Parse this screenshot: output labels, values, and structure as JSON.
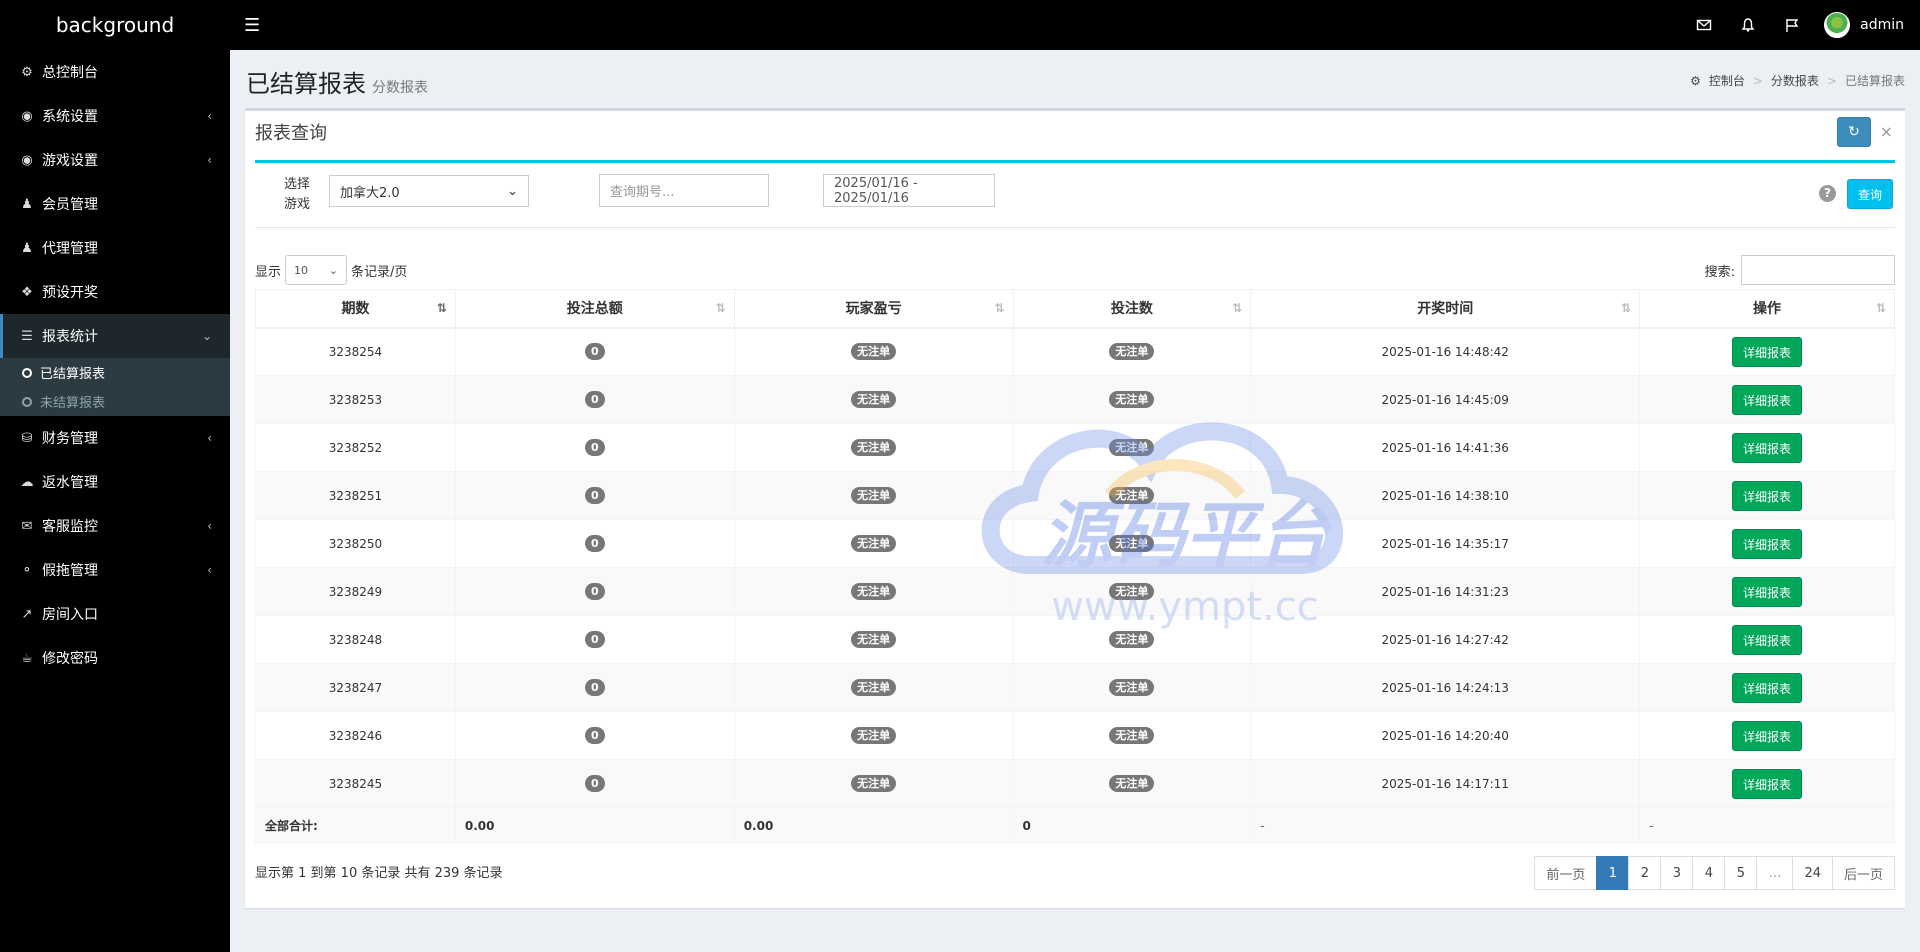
{
  "header": {
    "logo": "background",
    "menu_icon": "hamburger-icon",
    "icons": [
      "envelope-icon",
      "bell-icon",
      "flag-icon"
    ],
    "username": "admin"
  },
  "sidebar": {
    "items": [
      {
        "label": "总控制台",
        "icon": "dashboard-icon",
        "chevron": false
      },
      {
        "label": "系统设置",
        "icon": "gamepad-icon",
        "chevron": true
      },
      {
        "label": "游戏设置",
        "icon": "gamepad-icon",
        "chevron": true
      },
      {
        "label": "会员管理",
        "icon": "users-icon",
        "chevron": false
      },
      {
        "label": "代理管理",
        "icon": "users-icon",
        "chevron": false
      },
      {
        "label": "预设开奖",
        "icon": "cubes-icon",
        "chevron": false
      },
      {
        "label": "报表统计",
        "icon": "list-icon",
        "chevron": true,
        "expanded": true
      },
      {
        "label": "财务管理",
        "icon": "database-icon",
        "chevron": true
      },
      {
        "label": "返水管理",
        "icon": "cloud-upload-icon",
        "chevron": false
      },
      {
        "label": "客服监控",
        "icon": "chat-icon",
        "chevron": true
      },
      {
        "label": "假拖管理",
        "icon": "comment-icon",
        "chevron": true
      },
      {
        "label": "房间入口",
        "icon": "external-link-icon",
        "chevron": false
      },
      {
        "label": "修改密码",
        "icon": "cart-icon",
        "chevron": false
      }
    ],
    "sub_items": [
      {
        "label": "已结算报表",
        "active": true
      },
      {
        "label": "未结算报表",
        "active": false
      }
    ]
  },
  "page": {
    "title": "已结算报表",
    "subtitle": "分数报表",
    "breadcrumb": [
      "控制台",
      "分数报表",
      "已结算报表"
    ]
  },
  "box": {
    "title": "报表查询"
  },
  "filters": {
    "game_label": "选择游戏",
    "game_value": "加拿大2.0",
    "period_placeholder": "查询期号...",
    "date_range": "2025/01/16 - 2025/01/16",
    "query_label": "查询"
  },
  "table_controls": {
    "show_label": "显示",
    "page_size": "10",
    "per_page_label": "条记录/页",
    "search_label": "搜索:"
  },
  "table": {
    "columns": [
      "期数",
      "投注总额",
      "玩家盈亏",
      "投注数",
      "开奖时间",
      "操作"
    ],
    "no_bet_label": "无注单",
    "detail_label": "详细报表",
    "rows": [
      {
        "period": "3238254",
        "total": "0",
        "time": "2025-01-16 14:48:42"
      },
      {
        "period": "3238253",
        "total": "0",
        "time": "2025-01-16 14:45:09"
      },
      {
        "period": "3238252",
        "total": "0",
        "time": "2025-01-16 14:41:36"
      },
      {
        "period": "3238251",
        "total": "0",
        "time": "2025-01-16 14:38:10"
      },
      {
        "period": "3238250",
        "total": "0",
        "time": "2025-01-16 14:35:17"
      },
      {
        "period": "3238249",
        "total": "0",
        "time": "2025-01-16 14:31:23"
      },
      {
        "period": "3238248",
        "total": "0",
        "time": "2025-01-16 14:27:42"
      },
      {
        "period": "3238247",
        "total": "0",
        "time": "2025-01-16 14:24:13"
      },
      {
        "period": "3238246",
        "total": "0",
        "time": "2025-01-16 14:20:40"
      },
      {
        "period": "3238245",
        "total": "0",
        "time": "2025-01-16 14:17:11"
      }
    ],
    "footer": {
      "label": "全部合计:",
      "total_bet": "0.00",
      "player_pl": "0.00",
      "bet_count": "0",
      "time": "-",
      "action": "-"
    }
  },
  "pagination": {
    "info": "显示第 1 到第 10 条记录 共有 239 条记录",
    "prev": "前一页",
    "pages": [
      "1",
      "2",
      "3",
      "4",
      "5",
      "…",
      "24"
    ],
    "current": "1",
    "next": "后一页"
  },
  "watermark": {
    "text": "源码平台",
    "url": "www.ympt.cc"
  }
}
